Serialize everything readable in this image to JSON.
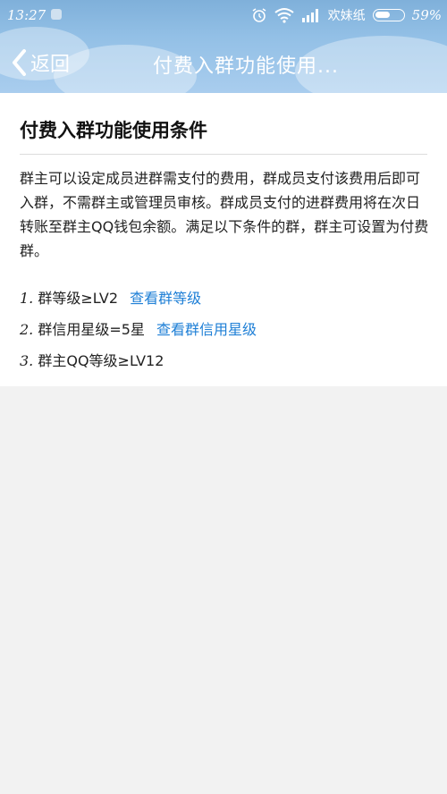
{
  "status_bar": {
    "time": "13:27",
    "carrier": "欢妹纸",
    "battery_percent": "59%",
    "battery_level": 0.59,
    "icons": [
      "notification-icon",
      "alarm-icon",
      "wifi-icon",
      "signal-icon",
      "battery-icon"
    ]
  },
  "nav": {
    "back_label": "返回",
    "title": "付费入群功能使用..."
  },
  "content": {
    "title": "付费入群功能使用条件",
    "paragraph": "群主可以设定成员进群需支付的费用，群成员支付该费用后即可入群，不需群主或管理员审核。群成员支付的进群费用将在次日转账至群主QQ钱包余额。满足以下条件的群，群主可设置为付费群。",
    "conditions": [
      {
        "num": "1.",
        "text": "群等级≥LV2",
        "link": "查看群等级"
      },
      {
        "num": "2.",
        "text": "群信用星级=5星",
        "link": "查看群信用星级"
      },
      {
        "num": "3.",
        "text": "群主QQ等级≥LV12",
        "link": ""
      }
    ]
  },
  "colors": {
    "link": "#1e7fd6",
    "header_gradient_top": "#7fb0da",
    "header_gradient_bottom": "#a9cdee",
    "page_background": "#f2f2f2"
  }
}
